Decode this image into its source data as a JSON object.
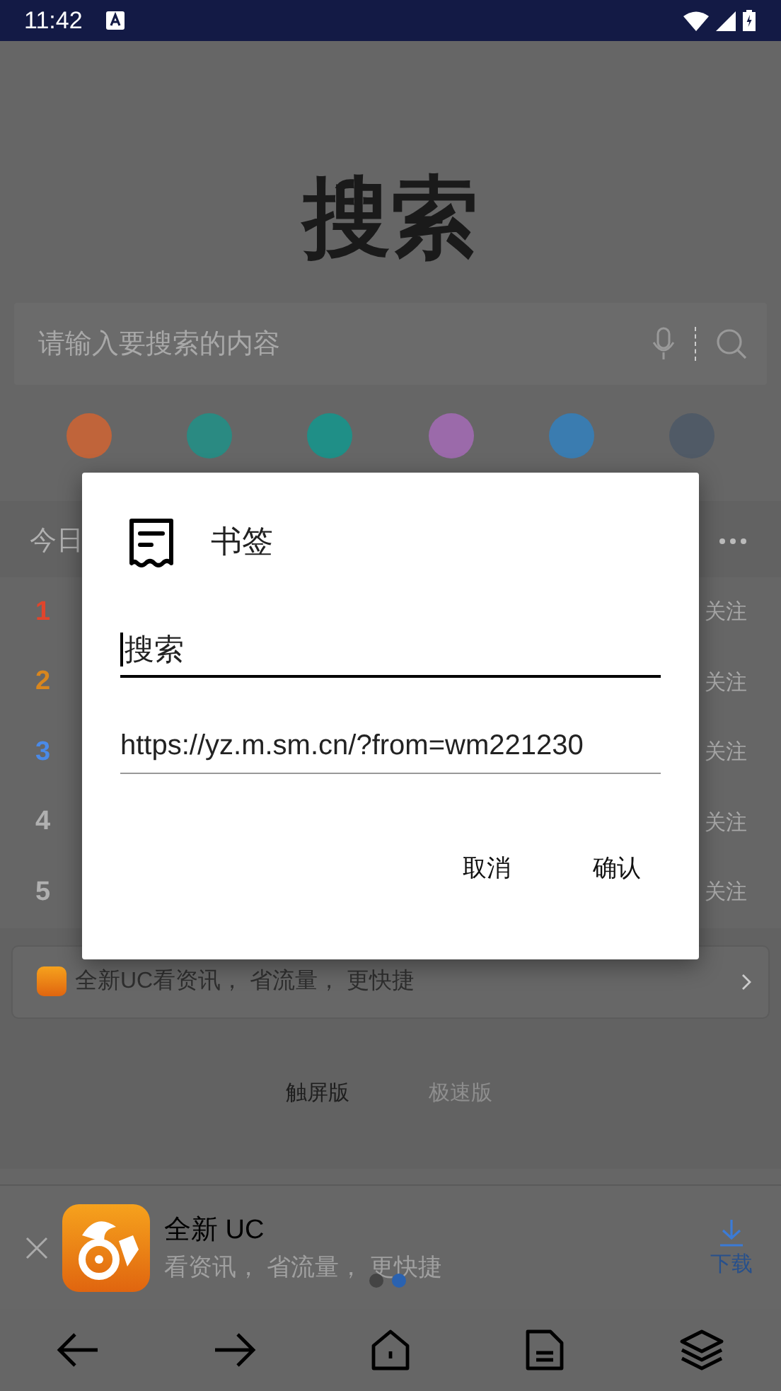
{
  "status_bar": {
    "time": "11:42"
  },
  "logo": "搜索",
  "search": {
    "placeholder": "请输入要搜索的内容"
  },
  "shortcuts": [
    {
      "color": "#c0643a"
    },
    {
      "color": "#2a8a82"
    },
    {
      "color": "#1f8f87"
    },
    {
      "color": "#9b6aaa"
    },
    {
      "color": "#3a7cb0"
    },
    {
      "color": "#505a66"
    }
  ],
  "hot_list": {
    "title": "今日",
    "items": [
      {
        "rank": "1",
        "color": "#e0452c",
        "action": "关注"
      },
      {
        "rank": "2",
        "color": "#d8861e",
        "action": "关注"
      },
      {
        "rank": "3",
        "color": "#4a8ae8",
        "action": "关注"
      },
      {
        "rank": "4",
        "color": "#b0b0b0",
        "action": "关注"
      },
      {
        "rank": "5",
        "color": "#b0b0b0",
        "action": "关注"
      }
    ]
  },
  "promo": {
    "text": "全新UC看资讯， 省流量， 更快捷"
  },
  "version_tabs": [
    {
      "label": "触屏版",
      "selected": true
    },
    {
      "label": "极速版",
      "selected": false
    }
  ],
  "app_banner": {
    "title": "全新 UC",
    "subtitle": "看资讯， 省流量， 更快捷",
    "action": "下载",
    "pages": [
      {
        "selected": false
      },
      {
        "selected": true
      }
    ]
  },
  "dialog": {
    "title": "书签",
    "fields": [
      {
        "value": "搜索",
        "focused": true
      },
      {
        "value": "https://yz.m.sm.cn/?from=wm221230",
        "focused": false
      }
    ],
    "buttons": [
      "取消",
      "确认"
    ]
  }
}
